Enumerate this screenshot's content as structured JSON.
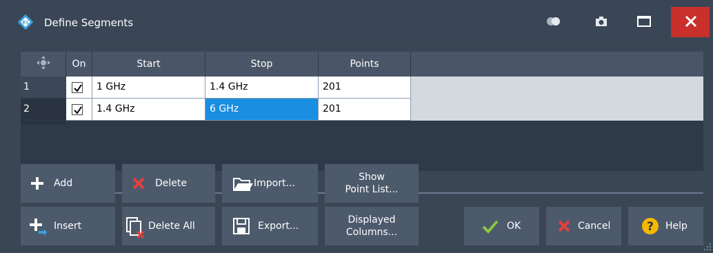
{
  "window": {
    "title": "Define Segments",
    "close_glyph": "✕"
  },
  "table": {
    "columns": [
      "On",
      "Start",
      "Stop",
      "Points"
    ],
    "rows": [
      {
        "num": "1",
        "on": true,
        "start": "1 GHz",
        "stop": "1.4 GHz",
        "points": "201"
      },
      {
        "num": "2",
        "on": true,
        "start": "1.4 GHz",
        "stop": "6 GHz",
        "points": "201"
      }
    ],
    "selected_cell": {
      "row": 2,
      "column": "Stop"
    }
  },
  "buttons": {
    "add": "Add",
    "insert": "Insert",
    "delete": "Delete",
    "delete_all": "Delete All",
    "import": "Import...",
    "export": "Export...",
    "show_point_list_1": "Show",
    "show_point_list_2": "Point List...",
    "displayed_columns_1": "Displayed",
    "displayed_columns_2": "Columns...",
    "ok": "OK",
    "cancel": "Cancel",
    "help": "Help"
  },
  "icons": {
    "logo": "rohde-schwarz-logo-icon",
    "toggle": "toggle-icon",
    "camera": "camera-icon",
    "maximize": "maximize-icon",
    "close": "close-icon",
    "move": "move-icon",
    "add": "plus-icon",
    "insert": "insert-icon",
    "delete": "x-icon",
    "delete_all": "delete-all-icon",
    "import": "folder-open-icon",
    "export": "save-icon",
    "ok": "check-icon",
    "cancel": "x-icon",
    "help": "question-icon"
  },
  "colors": {
    "accent_blue": "#1a8ee0",
    "close_red": "#c9302c",
    "delete_red": "#e8403a",
    "ok_green": "#8cc63f",
    "help_yellow": "#f5b800"
  }
}
